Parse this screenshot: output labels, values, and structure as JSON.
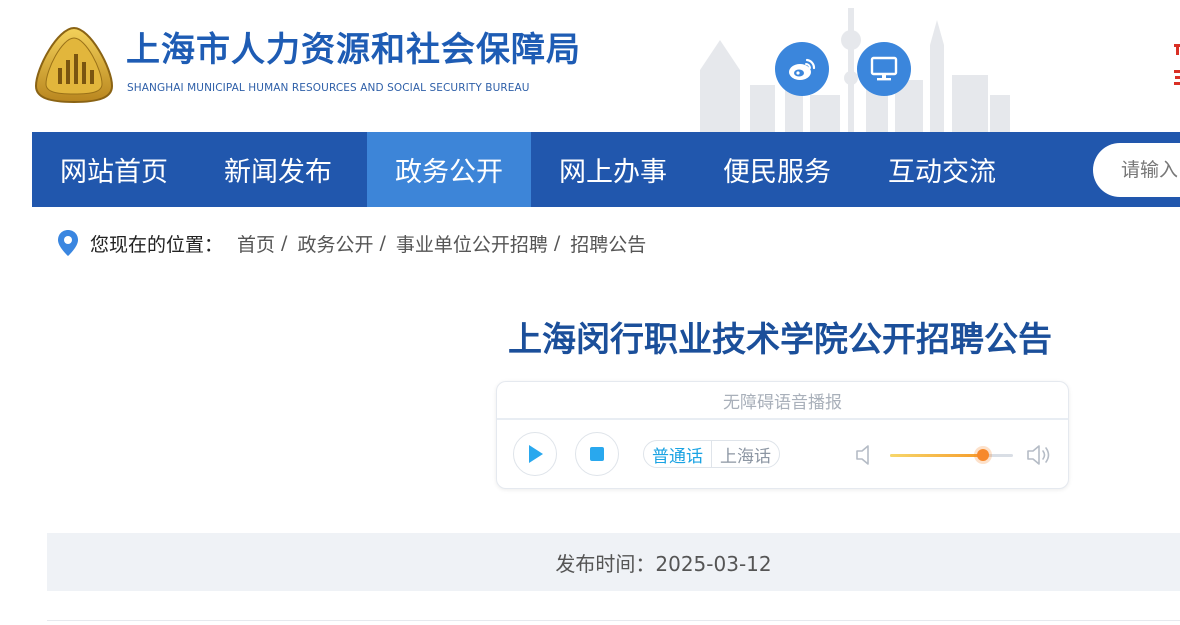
{
  "header": {
    "site_title": "上海市人力资源和社会保障局",
    "site_subtitle": "SHANGHAI MUNICIPAL HUMAN RESOURCES AND SOCIAL SECURITY BUREAU",
    "icons": [
      "emblem-logo",
      "weibo-icon",
      "computer-icon"
    ]
  },
  "nav": {
    "items": [
      {
        "label": "网站首页"
      },
      {
        "label": "新闻发布"
      },
      {
        "label": "政务公开",
        "active": true
      },
      {
        "label": "网上办事"
      },
      {
        "label": "便民服务"
      },
      {
        "label": "互动交流"
      }
    ],
    "search_placeholder": "请输入"
  },
  "breadcrumb": {
    "label": "您现在的位置：",
    "items": [
      "首页",
      "政务公开",
      "事业单位公开招聘",
      "招聘公告"
    ],
    "separator": "/"
  },
  "article": {
    "title": "上海闵行职业技术学院公开招聘公告",
    "publish_time": "发布时间：2025-03-12"
  },
  "player": {
    "header": "无障碍语音播报",
    "languages": [
      "普通话",
      "上海话"
    ],
    "active_language": "普通话",
    "volume": 0.76
  },
  "colors": {
    "nav_bg": "#2157ad",
    "nav_active": "#3d85d8",
    "title": "#1b4f9a",
    "accent_blue": "#3b86dc",
    "volume_knob": "#f7892b"
  }
}
